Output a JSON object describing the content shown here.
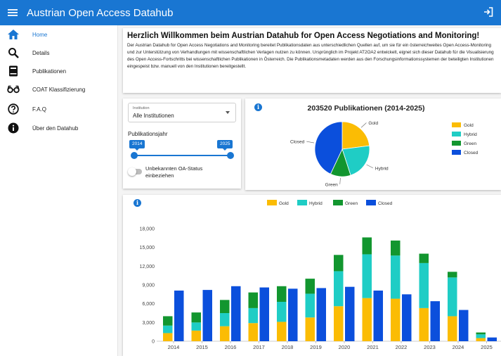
{
  "app": {
    "title": "Austrian Open Access Datahub"
  },
  "sidebar": {
    "items": [
      {
        "label": "Home",
        "icon": "home-icon",
        "active": true
      },
      {
        "label": "Details",
        "icon": "search-icon"
      },
      {
        "label": "Publikationen",
        "icon": "book-icon"
      },
      {
        "label": "COAT Klassifizierung",
        "icon": "glasses-icon"
      },
      {
        "label": "F.A.Q",
        "icon": "help-circle-icon"
      },
      {
        "label": "Über den Datahub",
        "icon": "info-icon"
      }
    ]
  },
  "intro": {
    "heading": "Herzlich Willkommen beim Austrian Datahub for Open Access Negotiations and Monitoring!",
    "body": "Der Austrian Datahub for Open Access Negotiations and Monitoring bereitet Publikationsdaten aus unterschiedlichen Quellen auf, um sie für ein österreichweites Open Access-Monitoring und zur Unterstützung von Verhandlungen mit wissenschaftlichen Verlagen nutzen zu können. Ursprünglich im Projekt AT2OA2 entwickelt, eignet sich dieser Datahub für die Visualisierung des Open Access-Fortschritts bei wissenschaftlichen Publikationen in Österreich. Die Publikationsmetadaten werden aus den Forschungsinformationssystemen der beteiligten Institutionen eingespeist bzw. manuell von den Institutionen bereitgestellt."
  },
  "filters": {
    "institution_label": "Institution",
    "institution_value": "Alle Institutionen",
    "year_label": "Publikationsjahr",
    "year_from": "2014",
    "year_to": "2025",
    "toggle_label": "Unbekannten OA-Status einbeziehen",
    "toggle_on": false
  },
  "colors": {
    "Gold": "#fbbc04",
    "Hybrid": "#1fcdc5",
    "Green": "#12962f",
    "Closed": "#0b4fdc",
    "accent": "#1976d2"
  },
  "chart_data": [
    {
      "type": "pie",
      "title": "203520 Publikationen (2014-2025)",
      "categories": [
        "Gold",
        "Hybrid",
        "Green",
        "Closed"
      ],
      "values": [
        23,
        22,
        12,
        43
      ],
      "legend": "right"
    },
    {
      "type": "bar",
      "categories": [
        "2014",
        "2015",
        "2016",
        "2017",
        "2018",
        "2019",
        "2020",
        "2021",
        "2022",
        "2023",
        "2024",
        "2025"
      ],
      "stacked_series": [
        {
          "name": "Gold",
          "values": [
            1300,
            1700,
            2400,
            2900,
            3100,
            3800,
            5600,
            6900,
            6800,
            5300,
            4000,
            500
          ]
        },
        {
          "name": "Hybrid",
          "values": [
            1200,
            1300,
            2100,
            2400,
            3200,
            3800,
            5600,
            7000,
            6900,
            7200,
            6200,
            600
          ]
        },
        {
          "name": "Green",
          "values": [
            1500,
            1600,
            2100,
            2500,
            2500,
            2400,
            2600,
            2700,
            2400,
            1500,
            900,
            300
          ]
        }
      ],
      "series": [
        {
          "name": "Closed",
          "values": [
            8100,
            8200,
            8800,
            8600,
            8400,
            8500,
            8700,
            8100,
            7500,
            6400,
            5000,
            600
          ]
        }
      ],
      "ylim": [
        0,
        18000
      ],
      "yticks": [
        "0",
        "3,000",
        "6,000",
        "9,000",
        "12,000",
        "15,000",
        "18,000"
      ],
      "legend": "top",
      "grid": false
    }
  ]
}
